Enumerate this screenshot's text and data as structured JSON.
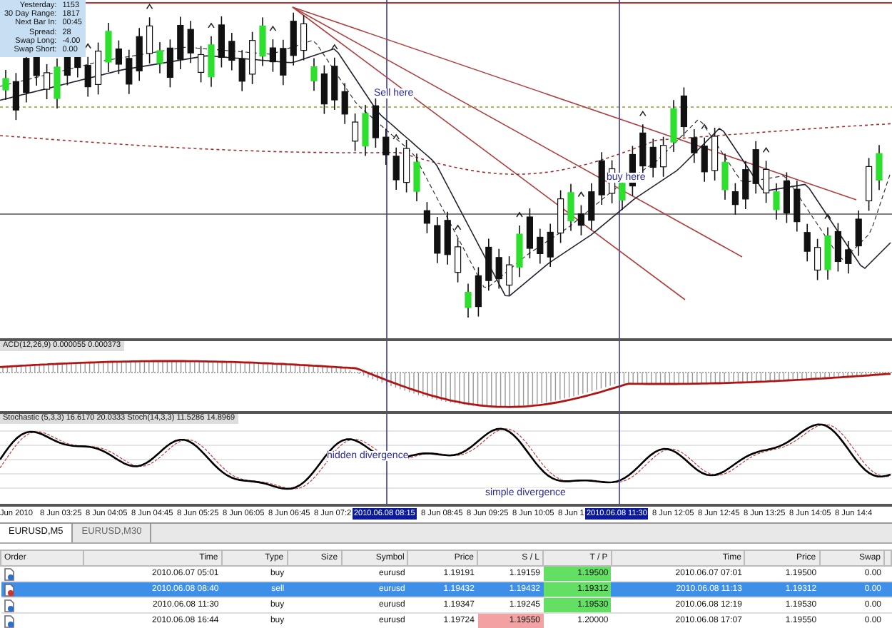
{
  "info_panel": [
    {
      "label": "Yesterday:",
      "value": "1153"
    },
    {
      "label": "30 Day Range:",
      "value": "1817"
    },
    {
      "label": "Next Bar In:",
      "value": "00:45"
    },
    {
      "label": "Spread:",
      "value": "28"
    },
    {
      "label": "Swap Long:",
      "value": "-4.00"
    },
    {
      "label": "Swap Short:",
      "value": "0.00"
    }
  ],
  "main_chart": {
    "annotations": [
      {
        "text": "Sell here"
      },
      {
        "text": "buy here"
      }
    ]
  },
  "macd_panel": {
    "label": "ACD(12,26,9) 0.000055 0.000373"
  },
  "stochastic_panel": {
    "label": "Stochastic (5,3,3) 16.6170 20.0333  Stoch(14,3,3) 11.5286 14.8969",
    "annotations": [
      {
        "text": "hidden divergence"
      },
      {
        "text": "simple divergence"
      }
    ]
  },
  "time_axis": [
    {
      "kind": "tick",
      "text": "Jun 2010"
    },
    {
      "kind": "tick",
      "text": "8 Jun 03:25"
    },
    {
      "kind": "tick",
      "text": "8 Jun 04:05"
    },
    {
      "kind": "tick",
      "text": "8 Jun 04:45"
    },
    {
      "kind": "tick",
      "text": "8 Jun 05:25"
    },
    {
      "kind": "tick",
      "text": "8 Jun 06:05"
    },
    {
      "kind": "tick",
      "text": "8 Jun 06:45"
    },
    {
      "kind": "tick",
      "text": "8 Jun 07:2"
    },
    {
      "kind": "cursor",
      "text": "2010.06.08 08:15"
    },
    {
      "kind": "tick",
      "text": "8 Jun 08:45"
    },
    {
      "kind": "tick",
      "text": "8 Jun 09:25"
    },
    {
      "kind": "tick",
      "text": "8 Jun 10:05"
    },
    {
      "kind": "tick",
      "text": "8 Jun 1"
    },
    {
      "kind": "cursor",
      "text": "2010.06.08 11:30"
    },
    {
      "kind": "tick",
      "text": "8 Jun 12:05"
    },
    {
      "kind": "tick",
      "text": "8 Jun 12:45"
    },
    {
      "kind": "tick",
      "text": "8 Jun 13:25"
    },
    {
      "kind": "tick",
      "text": "8 Jun 14:05"
    },
    {
      "kind": "tick",
      "text": "8 Jun 14:4"
    }
  ],
  "tabs": [
    {
      "label": "EURUSD,M5",
      "selected": true
    },
    {
      "label": "EURUSD,M30",
      "selected": false
    }
  ],
  "table": {
    "columns": [
      "Order",
      "Time",
      "Type",
      "Size",
      "Symbol",
      "Price",
      "S / L",
      "T / P",
      "Time",
      "Price",
      "Swap"
    ],
    "rows": [
      {
        "selected": false,
        "time": "2010.06.07 05:01",
        "type": "buy",
        "symbol": "eurusd",
        "price": "1.19191",
        "sl": "1.19159",
        "tp": "1.19500",
        "sl_hit": false,
        "tp_hit": true,
        "close_time": "2010.06.07 07:01",
        "close_price": "1.19500",
        "swap": "0.00"
      },
      {
        "selected": true,
        "time": "2010.06.08 08:40",
        "type": "sell",
        "symbol": "eurusd",
        "price": "1.19432",
        "sl": "1.19432",
        "tp": "1.19312",
        "sl_hit": false,
        "tp_hit": true,
        "close_time": "2010.06.08 11:13",
        "close_price": "1.19312",
        "swap": "0.00"
      },
      {
        "selected": false,
        "time": "2010.06.08 11:30",
        "type": "buy",
        "symbol": "eurusd",
        "price": "1.19347",
        "sl": "1.19245",
        "tp": "1.19530",
        "sl_hit": false,
        "tp_hit": true,
        "close_time": "2010.06.08 12:19",
        "close_price": "1.19530",
        "swap": "0.00"
      },
      {
        "selected": false,
        "time": "2010.06.08 16:44",
        "type": "buy",
        "symbol": "eurusd",
        "price": "1.19724",
        "sl": "1.19550",
        "tp": "1.20000",
        "sl_hit": true,
        "tp_hit": false,
        "close_time": "2010.06.08 17:07",
        "close_price": "1.19550",
        "swap": "0.00"
      }
    ]
  }
}
